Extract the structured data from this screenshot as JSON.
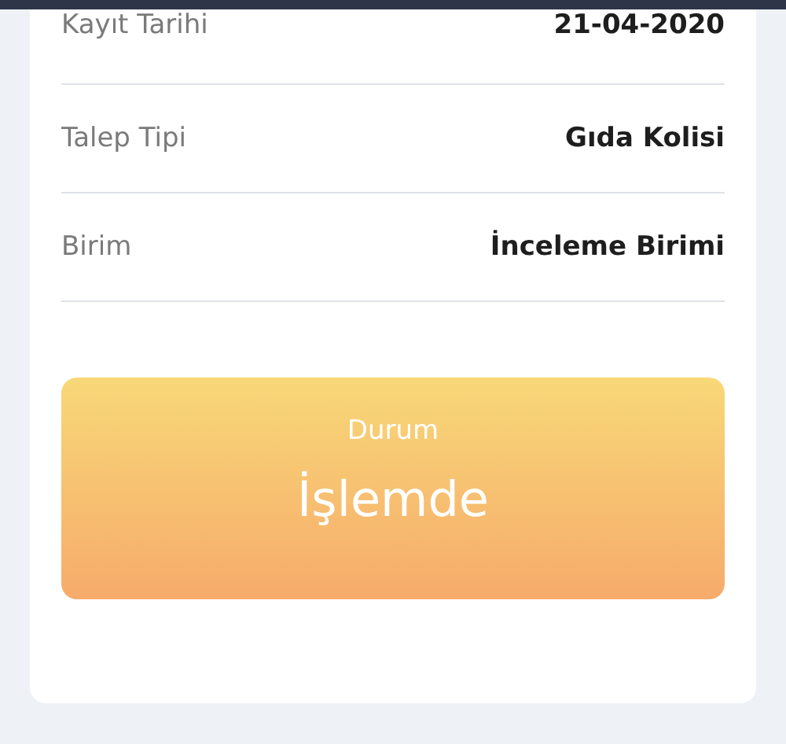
{
  "details": [
    {
      "label": "Kayıt Tarihi",
      "value": "21-04-2020"
    },
    {
      "label": "Talep Tipi",
      "value": "Gıda Kolisi"
    },
    {
      "label": "Birim",
      "value": "İnceleme Birimi"
    }
  ],
  "status": {
    "label": "Durum",
    "value": "İşlemde"
  }
}
